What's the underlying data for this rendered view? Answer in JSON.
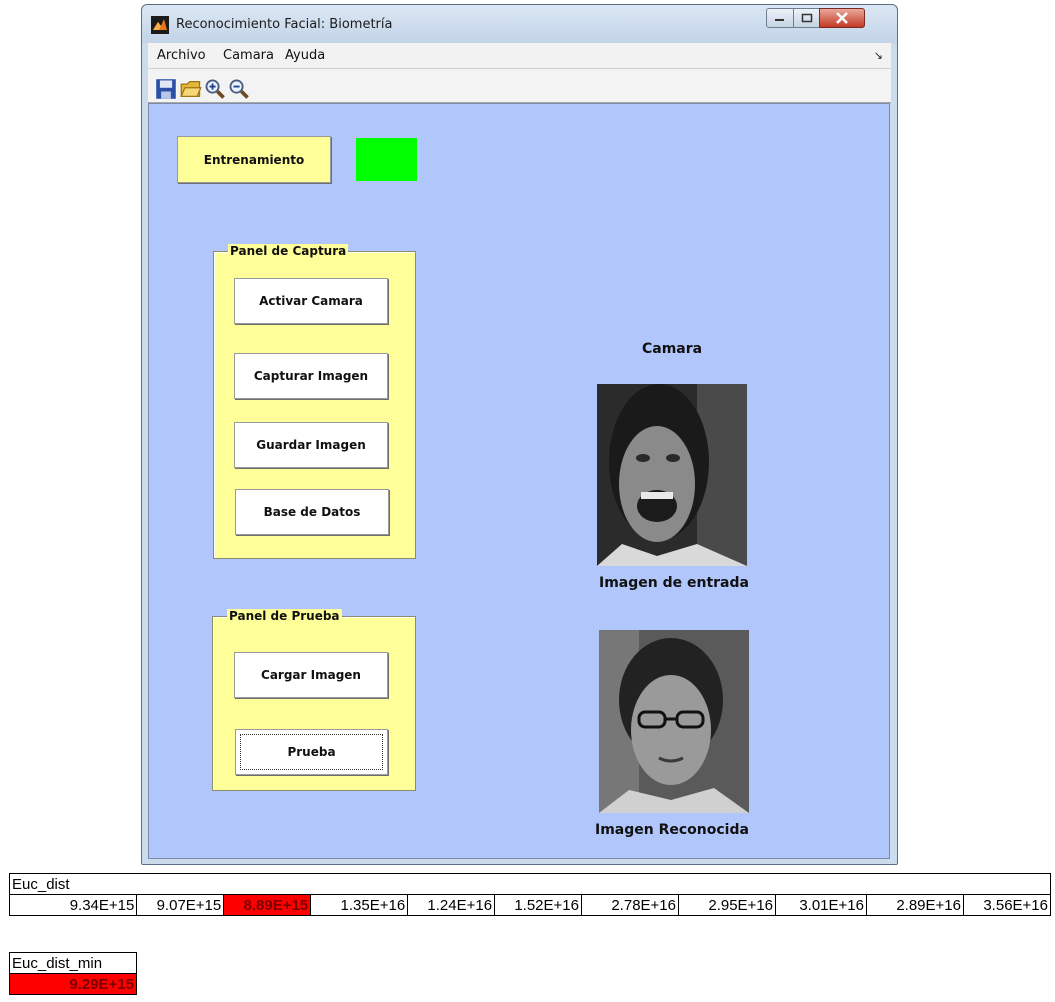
{
  "window": {
    "title": "Reconocimiento Facial: Biometría",
    "menu": [
      "Archivo",
      "Camara",
      "Ayuda"
    ],
    "toolbar_icons": [
      "save-icon",
      "open-folder-icon",
      "zoom-in-icon",
      "zoom-out-icon"
    ]
  },
  "main": {
    "train_button": "Entrenamiento",
    "status_indicator_color": "#00ff00",
    "capture_panel": {
      "title": "Panel de Captura",
      "buttons": [
        "Activar Camara",
        "Capturar Imagen",
        "Guardar  Imagen",
        "Base de Datos"
      ]
    },
    "test_panel": {
      "title": "Panel de Prueba",
      "buttons": [
        "Cargar Imagen",
        "Prueba"
      ]
    },
    "camera_label": "Camara",
    "input_image_label": "Imagen de entrada",
    "recognized_image_label": "Imagen Reconocida"
  },
  "euc_dist": {
    "header": "Euc_dist",
    "values": [
      "9.34E+15",
      "9.07E+15",
      "8.89E+15",
      "1.35E+16",
      "1.24E+16",
      "1.52E+16",
      "2.78E+16",
      "2.95E+16",
      "3.01E+16",
      "2.89E+16",
      "3.56E+16"
    ],
    "highlight_index": 2,
    "highlight_color": "#ff0000"
  },
  "euc_dist_min": {
    "header": "Euc_dist_min",
    "value": "9.29E+15"
  }
}
